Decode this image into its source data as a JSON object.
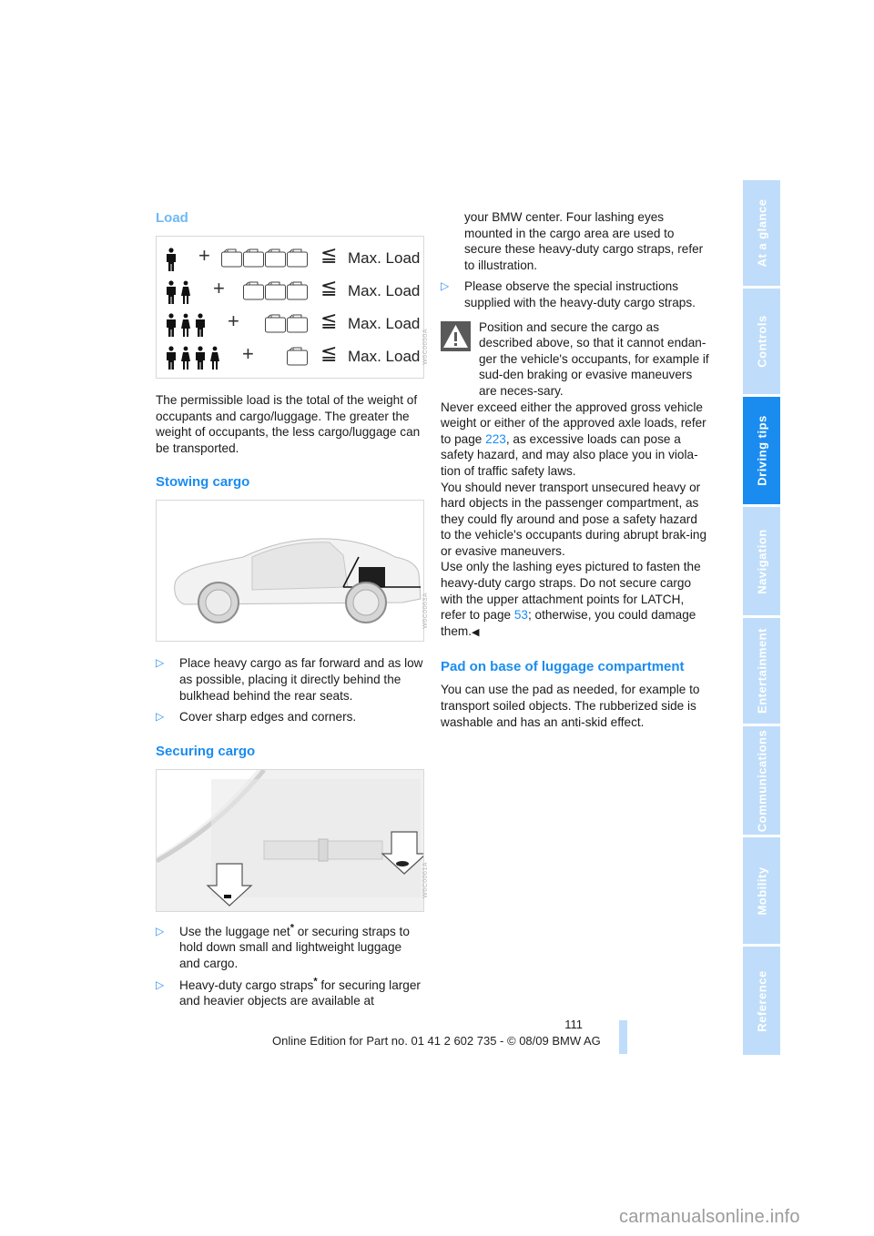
{
  "sidebar": {
    "tabs": [
      {
        "label": "At a glance",
        "active": false
      },
      {
        "label": "Controls",
        "active": false
      },
      {
        "label": "Driving tips",
        "active": true
      },
      {
        "label": "Navigation",
        "active": false
      },
      {
        "label": "Entertainment",
        "active": false
      },
      {
        "label": "Communications",
        "active": false
      },
      {
        "label": "Mobility",
        "active": false
      },
      {
        "label": "Reference",
        "active": false
      }
    ],
    "colors": {
      "inactive": "#bfddfa",
      "active": "#1a8cf0"
    }
  },
  "left": {
    "load": {
      "heading": "Load",
      "figure": {
        "rows": [
          {
            "people": 1,
            "bags": 4,
            "plus": "+",
            "relation": "≦",
            "label": "Max. Load"
          },
          {
            "people": 2,
            "bags": 3,
            "plus": "+",
            "relation": "≦",
            "label": "Max. Load"
          },
          {
            "people": 3,
            "bags": 2,
            "plus": "+",
            "relation": "≦",
            "label": "Max. Load"
          },
          {
            "people": 4,
            "bags": 1,
            "plus": "+",
            "relation": "≦",
            "label": "Max. Load"
          }
        ],
        "code": "W6C0050A"
      },
      "paragraph": "The permissible load is the total of the weight of occupants and cargo/luggage. The greater the weight of occupants, the less cargo/luggage can be transported."
    },
    "stowing": {
      "heading": "Stowing cargo",
      "figure_code": "W6C0063A",
      "bullets": [
        "Place heavy cargo as far forward and as low as possible, placing it directly behind the bulkhead behind the rear seats.",
        "Cover sharp edges and corners."
      ]
    },
    "securing": {
      "heading": "Securing cargo",
      "figure_code": "W6C0061A",
      "bullet1": {
        "a": "Use the luggage net",
        "star": "*",
        "b": " or securing straps to hold down small and lightweight luggage and cargo."
      },
      "bullet2": {
        "a": "Heavy-duty cargo straps",
        "star": "*",
        "b": " for securing larger and heavier objects are available at"
      }
    }
  },
  "right": {
    "continuation": "your BMW center. Four lashing eyes mounted in the cargo area are used to secure these heavy-duty cargo straps, refer to illustration.",
    "bullet": "Please observe the special instructions supplied with the heavy-duty cargo straps.",
    "warning": {
      "first": "Position and secure the cargo as described above, so that it cannot endan-ger the vehicle's occupants, for example if sud-den braking or evasive maneuvers are neces-sary.",
      "p2a": "Never exceed either the approved gross vehicle weight or either of the approved axle loads, refer to page ",
      "p2link": "223",
      "p2b": ", as excessive loads can pose a safety hazard, and may also place you in viola-tion of traffic safety laws.",
      "p3": "You should never transport unsecured heavy or hard objects in the passenger compartment, as they could fly around and pose a safety hazard to the vehicle's occupants during abrupt brak-ing or evasive maneuvers.",
      "p4a": "Use only the lashing eyes pictured to fasten the heavy-duty cargo straps. Do not secure cargo with the upper attachment points for LATCH, refer to page ",
      "p4link": "53",
      "p4b": "; otherwise, you could damage them.",
      "end_mark": "◀"
    },
    "pad": {
      "heading": "Pad on base of luggage compartment",
      "paragraph": "You can use the pad as needed, for example to transport soiled objects. The rubberized side is washable and has an anti-skid effect."
    }
  },
  "bullet_marker": "▷",
  "footer": {
    "page_number": "111",
    "edition": "Online Edition for Part no. 01 41 2 602 735 - © 08/09 BMW AG",
    "watermark": "carmanualsonline.info"
  }
}
